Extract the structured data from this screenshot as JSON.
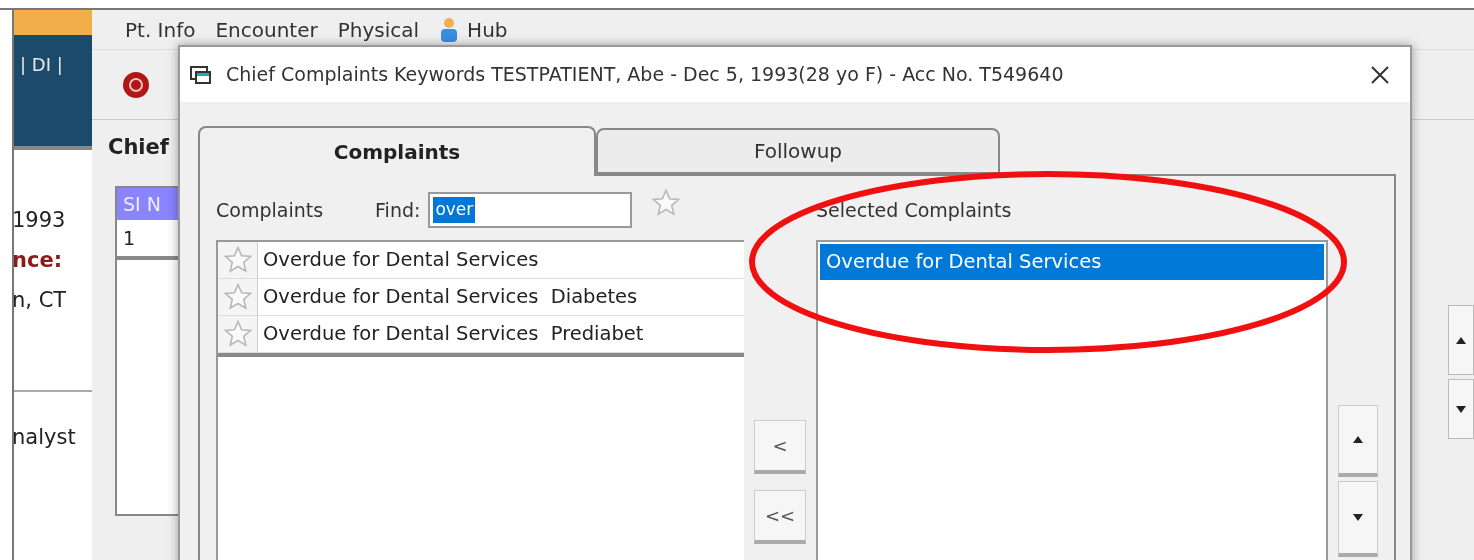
{
  "background_app": {
    "menu": [
      {
        "label": "Pt. Info",
        "kind": "text"
      },
      {
        "label": "Encounter",
        "kind": "text"
      },
      {
        "label": "Physical",
        "kind": "text"
      },
      {
        "label": "Hub",
        "kind": "icon"
      }
    ],
    "header_text": "| DI |",
    "section_title": "Chief",
    "patient_lines": [
      {
        "text": "1993",
        "kind": "plain"
      },
      {
        "text": "nce:",
        "kind": "label"
      },
      {
        "text": "n, CT",
        "kind": "plain"
      }
    ],
    "role_text": "nalyst",
    "table": {
      "columns": [
        "SI N"
      ],
      "rows": [
        [
          "1"
        ]
      ]
    }
  },
  "dialog": {
    "title": "Chief Complaints Keywords TESTPATIENT, Abe - Dec 5, 1993(28 yo F) - Acc No. T549640",
    "tabs": [
      {
        "label": "Complaints",
        "selected": true
      },
      {
        "label": "Followup",
        "selected": false
      }
    ],
    "complaints_label": "Complaints",
    "find_label": "Find:",
    "find_value": "over",
    "complaints": [
      {
        "label": "Overdue for Dental Services"
      },
      {
        "label": "Overdue for Dental Services  Diabetes"
      },
      {
        "label": "Overdue for Dental Services  Prediabet"
      }
    ],
    "move_buttons": [
      "<",
      "<<"
    ],
    "selected_label": "Selected Complaints",
    "selected_complaints": [
      {
        "label": "Overdue for Dental Services",
        "selected": true
      }
    ]
  }
}
